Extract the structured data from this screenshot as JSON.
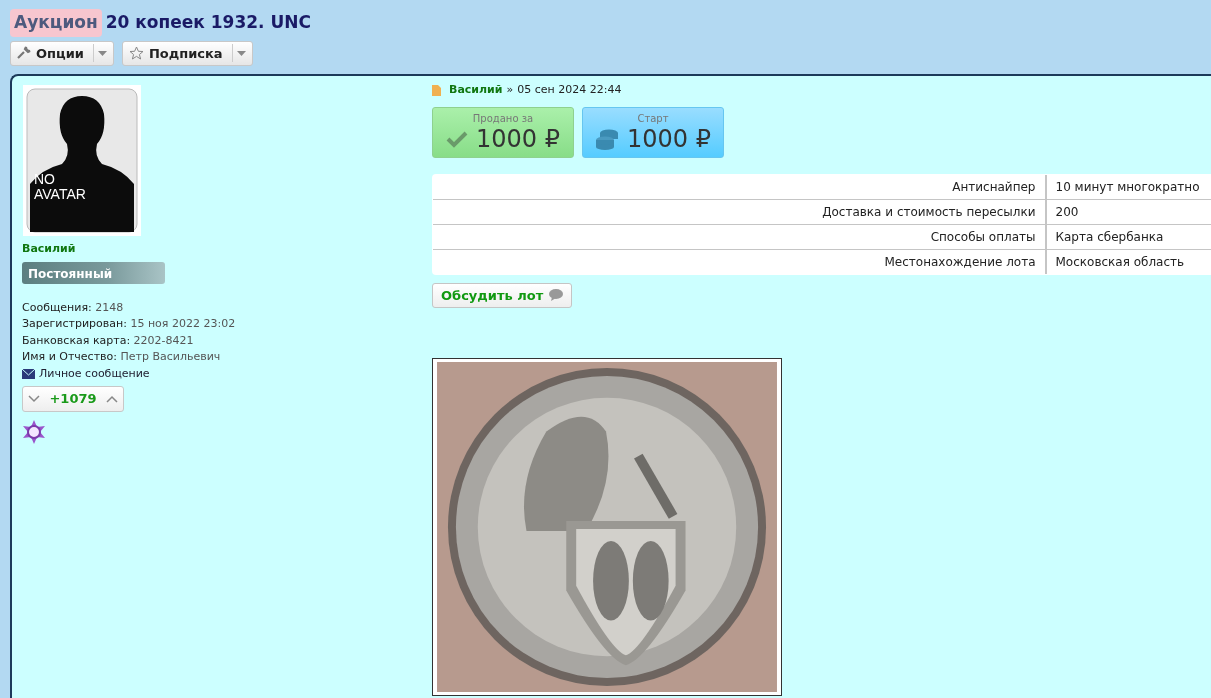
{
  "thread": {
    "prefix": "Аукцион",
    "title": "20 копеек 1932. UNC"
  },
  "toolbar": [
    {
      "kind": "wrench",
      "label": "Опции"
    },
    {
      "kind": "star",
      "label": "Подписка"
    }
  ],
  "user": {
    "avatar_label": "NO AVATAR",
    "name": "Василий",
    "rank": "Постоянный",
    "stats": [
      {
        "label": "Сообщения:",
        "value": "2148"
      },
      {
        "label": "Зарегистрирован:",
        "value": "15 ноя 2022 23:02"
      },
      {
        "label": "Банковская карта:",
        "value": "2202-8421"
      },
      {
        "label": "Имя и Отчество:",
        "value": "Петр Васильевич"
      }
    ],
    "pm_link": "Личное сообщение",
    "reputation": "+1079"
  },
  "post": {
    "author": "Василий",
    "separator": "»",
    "date": "05 сен 2024 22:44",
    "prices": [
      {
        "kind": "sold",
        "label": "Продано за",
        "amount": "1000 ₽"
      },
      {
        "kind": "start",
        "label": "Старт",
        "amount": "1000 ₽"
      }
    ],
    "details": [
      {
        "name": "Антиснайпер",
        "value": "10 минут многократно"
      },
      {
        "name": "Доставка и стоимость пересылки",
        "value": "200"
      },
      {
        "name": "Способы оплаты",
        "value": "Карта сбербанка"
      },
      {
        "name": "Местонахождение лота",
        "value": "Московская область"
      }
    ],
    "discuss_button": "Обсудить лот"
  }
}
